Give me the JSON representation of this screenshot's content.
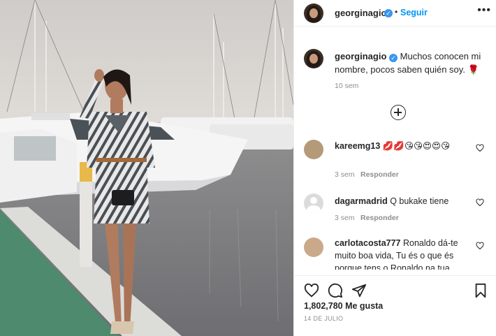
{
  "header": {
    "username": "georginagio",
    "separator": "•",
    "follow_label": "Seguir",
    "more_label": "•••"
  },
  "caption": {
    "username": "georginagio",
    "text": "Muchos conocen mi nombre, pocos saben quién soy. 🌹",
    "time": "10 sem"
  },
  "comments": [
    {
      "username": "kareemg13",
      "text": "💋💋😘😘😍😍😘",
      "time": "3 sem",
      "reply_label": "Responder"
    },
    {
      "username": "dagarmadrid",
      "text": "Q bukake tiene",
      "time": "3 sem",
      "reply_label": "Responder"
    },
    {
      "username": "carlotacosta777",
      "text": "Ronaldo dá-te muito boa vida, Tu és o que és porque tens o Ronaldo na tua",
      "time": "",
      "reply_label": ""
    }
  ],
  "actions": {
    "likes": "1,802,780 Me gusta",
    "date": "14 DE JULIO"
  },
  "colors": {
    "accent": "#0095f6",
    "verified": "#3897f0",
    "muted": "#8e8e8e",
    "text": "#262626"
  }
}
